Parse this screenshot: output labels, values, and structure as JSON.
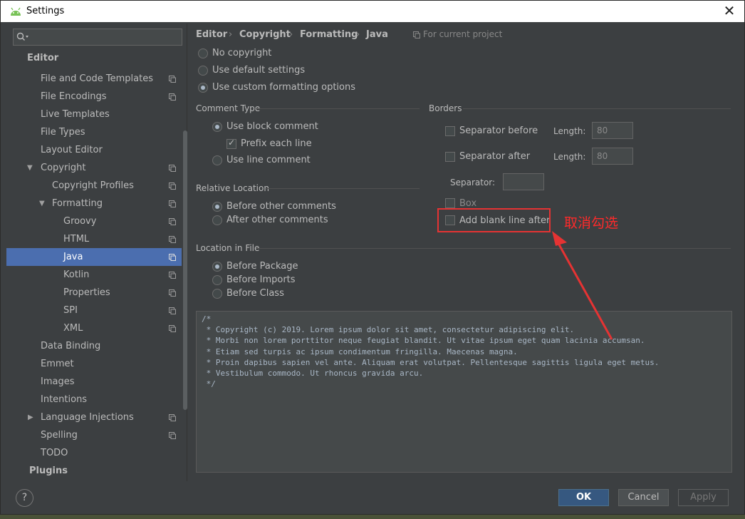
{
  "window": {
    "title": "Settings"
  },
  "sidebar": {
    "search_placeholder": "",
    "items": [
      {
        "label": "Editor"
      },
      {
        "label": "File and Code Templates"
      },
      {
        "label": "File Encodings"
      },
      {
        "label": "Live Templates"
      },
      {
        "label": "File Types"
      },
      {
        "label": "Layout Editor"
      },
      {
        "label": "Copyright"
      },
      {
        "label": "Copyright Profiles"
      },
      {
        "label": "Formatting"
      },
      {
        "label": "Groovy"
      },
      {
        "label": "HTML"
      },
      {
        "label": "Java"
      },
      {
        "label": "Kotlin"
      },
      {
        "label": "Properties"
      },
      {
        "label": "SPI"
      },
      {
        "label": "XML"
      },
      {
        "label": "Data Binding"
      },
      {
        "label": "Emmet"
      },
      {
        "label": "Images"
      },
      {
        "label": "Intentions"
      },
      {
        "label": "Language Injections"
      },
      {
        "label": "Spelling"
      },
      {
        "label": "TODO"
      },
      {
        "label": "Plugins"
      }
    ]
  },
  "breadcrumb": {
    "items": [
      "Editor",
      "Copyright",
      "Formatting",
      "Java"
    ],
    "separator": "›",
    "project": "For current project"
  },
  "copyright_mode": {
    "options": [
      "No copyright",
      "Use default settings",
      "Use custom formatting options"
    ],
    "selected": "Use custom formatting options"
  },
  "comment_type": {
    "title": "Comment Type",
    "block": "Use block comment",
    "prefix": "Prefix each line",
    "line": "Use line comment"
  },
  "relative_location": {
    "title": "Relative Location",
    "before": "Before other comments",
    "after": "After other comments"
  },
  "location_in_file": {
    "title": "Location in File",
    "options": [
      "Before Package",
      "Before Imports",
      "Before Class"
    ]
  },
  "borders": {
    "title": "Borders",
    "sep_before": "Separator before",
    "sep_after": "Separator after",
    "length_label": "Length:",
    "length_before": "80",
    "length_after": "80",
    "separator_label": "Separator:",
    "separator_value": "",
    "box": "Box",
    "add_blank": "Add blank line after"
  },
  "preview": {
    "lines": [
      "/*",
      " * Copyright (c) 2019. Lorem ipsum dolor sit amet, consectetur adipiscing elit.",
      " * Morbi non lorem porttitor neque feugiat blandit. Ut vitae ipsum eget quam lacinia accumsan.",
      " * Etiam sed turpis ac ipsum condimentum fringilla. Maecenas magna.",
      " * Proin dapibus sapien vel ante. Aliquam erat volutpat. Pellentesque sagittis ligula eget metus.",
      " * Vestibulum commodo. Ut rhoncus gravida arcu.",
      " */"
    ]
  },
  "annotation": {
    "text": "取消勾选",
    "color": "#e53333"
  },
  "buttons": {
    "help": "?",
    "ok": "OK",
    "cancel": "Cancel",
    "apply": "Apply"
  },
  "colors": {
    "selection": "#4b6eaf",
    "primary_button": "#365880"
  }
}
